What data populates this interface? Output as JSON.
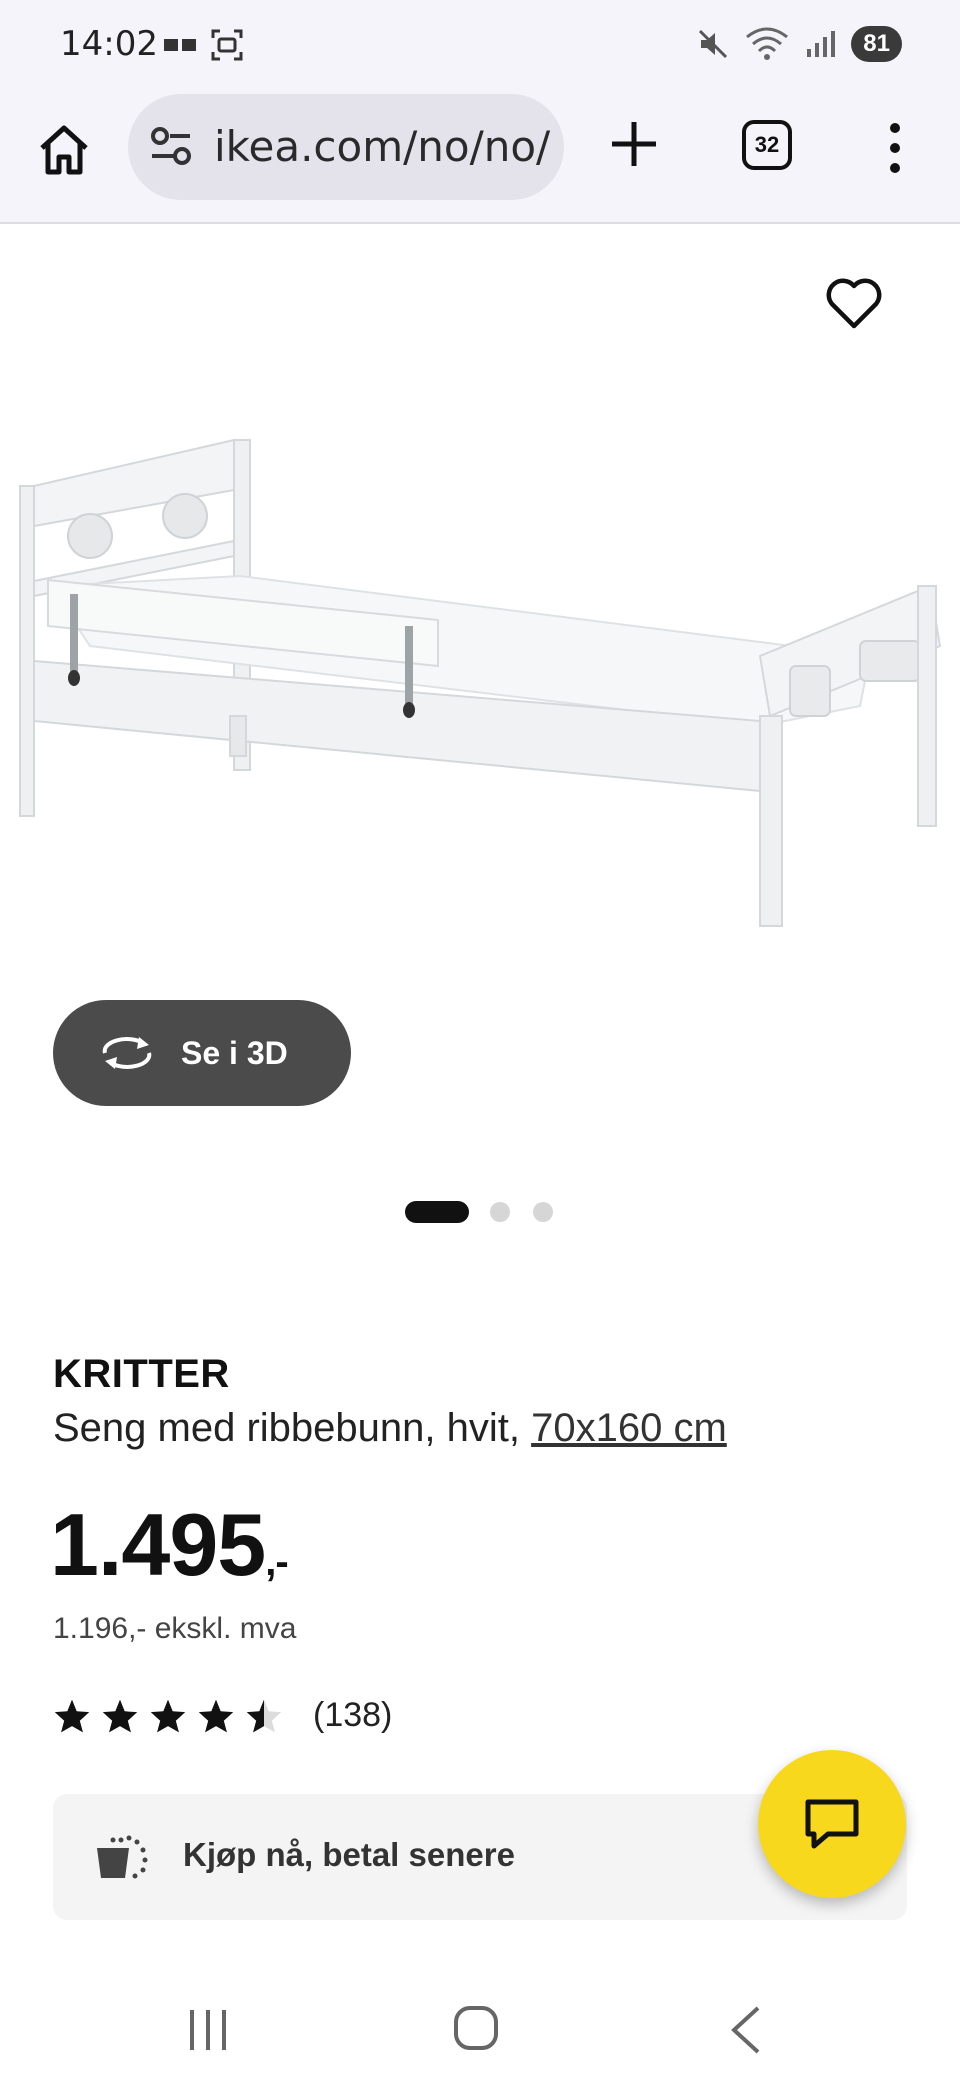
{
  "status": {
    "time": "14:02",
    "battery": "81",
    "left_icons": [
      "message-icon",
      "screenshot-icon"
    ],
    "right_icons": [
      "mute-icon",
      "wifi-icon",
      "signal-icon"
    ]
  },
  "browser": {
    "url": "ikea.com/no/no/p",
    "tab_count": "32"
  },
  "hero": {
    "view3d_label": "Se i 3D",
    "slides": 3,
    "active_slide": 0
  },
  "product": {
    "name": "KRITTER",
    "description": "Seng med ribbebunn, hvit, ",
    "size": "70x160 cm",
    "price": "1.495",
    "price_suffix": ",-",
    "price_ex_vat": "1.196,- ekskl. mva",
    "rating_value": 4.5,
    "rating_count": "(138)"
  },
  "payment": {
    "label": "Kjøp nå, betal senere"
  },
  "colors": {
    "chat_button": "#f8d81c",
    "view3d_button": "#4b4b4b",
    "toolbar_bg": "#f5f4fb"
  }
}
